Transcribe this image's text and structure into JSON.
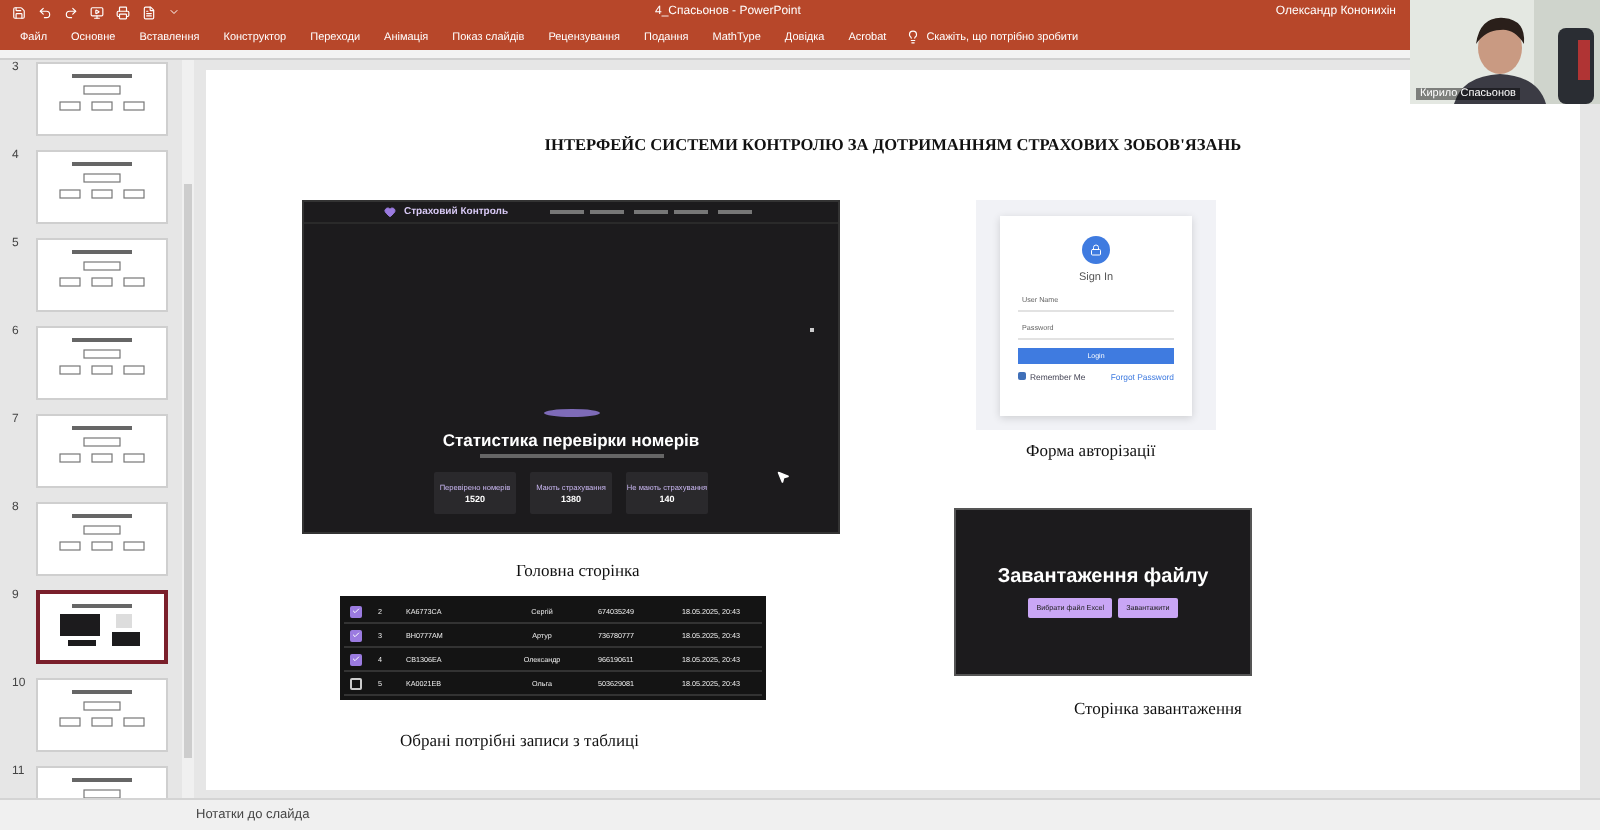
{
  "window": {
    "title": "4_Спасьонов - PowerPoint",
    "user": "Олександр Кононихін"
  },
  "ribbon": {
    "tabs": [
      {
        "label": "Файл",
        "selected": false
      },
      {
        "label": "Основне",
        "selected": false
      },
      {
        "label": "Вставлення",
        "selected": false
      },
      {
        "label": "Конструктор",
        "selected": false
      },
      {
        "label": "Переходи",
        "selected": false
      },
      {
        "label": "Анімація",
        "selected": false
      },
      {
        "label": "Показ слайдів",
        "selected": false
      },
      {
        "label": "Рецензування",
        "selected": false
      },
      {
        "label": "Подання",
        "selected": false
      },
      {
        "label": "MathType",
        "selected": false
      },
      {
        "label": "Довідка",
        "selected": false
      },
      {
        "label": "Acrobat",
        "selected": false
      }
    ],
    "tell_me": "Скажіть, що потрібно зробити"
  },
  "webcam": {
    "name": "Кирило Спасьонов"
  },
  "thumbnails": [
    {
      "number": "3",
      "selected": false
    },
    {
      "number": "4",
      "selected": false
    },
    {
      "number": "5",
      "selected": false
    },
    {
      "number": "6",
      "selected": false
    },
    {
      "number": "7",
      "selected": false
    },
    {
      "number": "8",
      "selected": false
    },
    {
      "number": "9",
      "selected": true
    },
    {
      "number": "10",
      "selected": false
    },
    {
      "number": "11",
      "selected": false
    }
  ],
  "slide": {
    "title": "ІНТЕРФЕЙС СИСТЕМИ КОНТРОЛЮ ЗА ДОТРИМАННЯМ СТРАХОВИХ ЗОБОВ'ЯЗАНЬ",
    "home": {
      "logo": "Страховий Контроль",
      "heading": "Статистика перевірки номерів",
      "stats": [
        {
          "label": "Перевірено номерів",
          "value": "1520"
        },
        {
          "label": "Мають страхування",
          "value": "1380"
        },
        {
          "label": "Не мають страхування",
          "value": "140"
        }
      ],
      "caption": "Головна сторінка"
    },
    "login": {
      "title": "Sign In",
      "fields": [
        {
          "placeholder": "User Name"
        },
        {
          "placeholder": "Password"
        }
      ],
      "button": "Login",
      "remember": {
        "label": "Remember Me",
        "checked": true
      },
      "forgot": "Forgot Password",
      "caption": "Форма авторізації"
    },
    "table": {
      "rows": [
        {
          "checked": true,
          "cells": [
            "2",
            "KA6773CA",
            "Сергій",
            "674035249",
            "18.05.2025, 20:43"
          ]
        },
        {
          "checked": true,
          "cells": [
            "3",
            "BH0777AM",
            "Артур",
            "736780777",
            "18.05.2025, 20:43"
          ]
        },
        {
          "checked": true,
          "cells": [
            "4",
            "CB1306EA",
            "Олександр",
            "966190611",
            "18.05.2025, 20:43"
          ]
        },
        {
          "checked": false,
          "cells": [
            "5",
            "KA0021EB",
            "Ольга",
            "503629081",
            "18.05.2025, 20:43"
          ]
        }
      ],
      "caption": "Обрані потрібні записи з таблиці"
    },
    "upload": {
      "heading": "Завантаження файлу",
      "buttons": [
        "Вибрати файл Excel",
        "Завантажити"
      ],
      "caption": "Сторінка завантаження"
    }
  },
  "status_bar": {
    "notes": "Нотатки до слайда"
  }
}
